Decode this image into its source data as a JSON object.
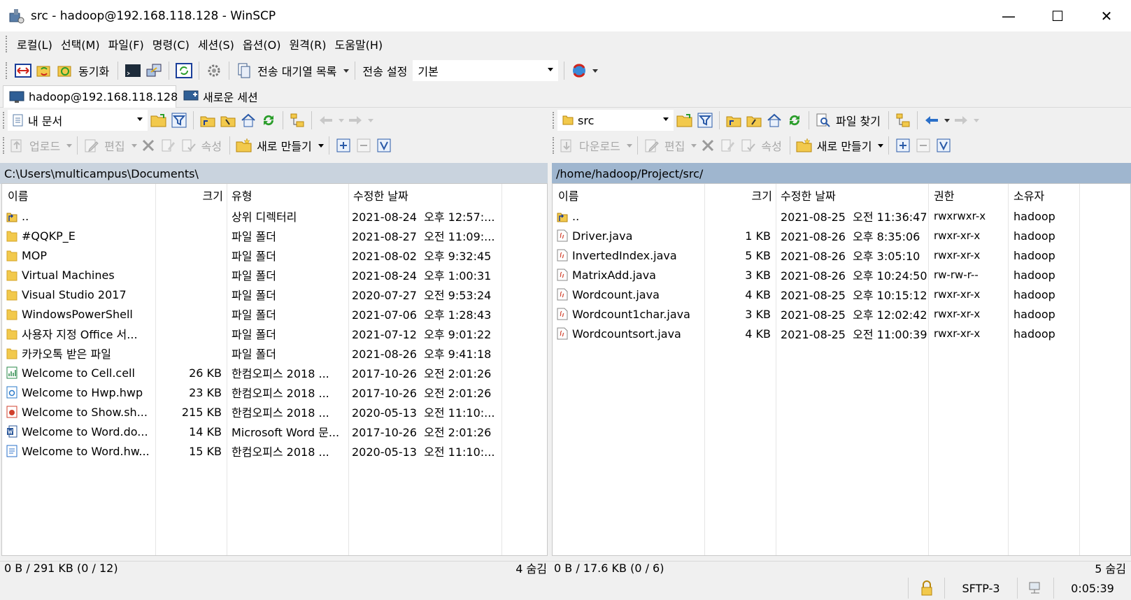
{
  "window": {
    "title": "src - hadoop@192.168.118.128 - WinSCP",
    "controls": {
      "minimize": "—",
      "maximize": "☐",
      "close": "✕"
    }
  },
  "menu": [
    "로컬(L)",
    "선택(M)",
    "파일(F)",
    "명령(C)",
    "세션(S)",
    "옵션(O)",
    "원격(R)",
    "도움말(H)"
  ],
  "toolbar": {
    "sync_label": "동기화",
    "queue_label": "전송 대기열 목록",
    "transfer_settings_label": "전송 설정",
    "transfer_preset": "기본"
  },
  "tabs": {
    "session": "hadoop@192.168.118.128",
    "new_session": "새로운 세션"
  },
  "local": {
    "location": "내 문서",
    "upload_label": "업로드",
    "edit_label": "편집",
    "properties_label": "속성",
    "new_label": "새로 만들기",
    "path": "C:\\Users\\multicampus\\Documents\\",
    "columns": {
      "name": "이름",
      "size": "크기",
      "type": "유형",
      "modified": "수정한 날짜"
    },
    "files": [
      {
        "icon": "parent-dir-icon",
        "name": "..",
        "size": "",
        "type": "상위 디렉터리",
        "modified": "2021-08-24  오후 12:57:..."
      },
      {
        "icon": "folder-icon",
        "name": "#QQKP_E",
        "size": "",
        "type": "파일 폴더",
        "modified": "2021-08-27  오전 11:09:..."
      },
      {
        "icon": "folder-icon",
        "name": "MOP",
        "size": "",
        "type": "파일 폴더",
        "modified": "2021-08-02  오후 9:32:45"
      },
      {
        "icon": "folder-icon",
        "name": "Virtual Machines",
        "size": "",
        "type": "파일 폴더",
        "modified": "2021-08-24  오후 1:00:31"
      },
      {
        "icon": "folder-icon",
        "name": "Visual Studio 2017",
        "size": "",
        "type": "파일 폴더",
        "modified": "2020-07-27  오전 9:53:24"
      },
      {
        "icon": "folder-icon",
        "name": "WindowsPowerShell",
        "size": "",
        "type": "파일 폴더",
        "modified": "2021-07-06  오후 1:28:43"
      },
      {
        "icon": "folder-icon",
        "name": "사용자 지정 Office 서...",
        "size": "",
        "type": "파일 폴더",
        "modified": "2021-07-12  오후 9:01:22"
      },
      {
        "icon": "folder-icon",
        "name": "카카오톡 받은 파일",
        "size": "",
        "type": "파일 폴더",
        "modified": "2021-08-26  오후 9:41:18"
      },
      {
        "icon": "cell-doc-icon",
        "name": "Welcome to Cell.cell",
        "size": "26 KB",
        "type": "한컴오피스 2018 ...",
        "modified": "2017-10-26  오전 2:01:26"
      },
      {
        "icon": "hwp-doc-icon",
        "name": "Welcome to Hwp.hwp",
        "size": "23 KB",
        "type": "한컴오피스 2018 ...",
        "modified": "2017-10-26  오전 2:01:26"
      },
      {
        "icon": "show-doc-icon",
        "name": "Welcome to Show.sh...",
        "size": "215 KB",
        "type": "한컴오피스 2018 ...",
        "modified": "2020-05-13  오전 11:10:..."
      },
      {
        "icon": "word-doc-icon",
        "name": "Welcome to Word.do...",
        "size": "14 KB",
        "type": "Microsoft Word 문...",
        "modified": "2017-10-26  오전 2:01:26"
      },
      {
        "icon": "hwp-word-icon",
        "name": "Welcome to Word.hw...",
        "size": "15 KB",
        "type": "한컴오피스 2018 ...",
        "modified": "2020-05-13  오전 11:10:..."
      }
    ],
    "status": "0 B / 291 KB (0 / 12)",
    "hidden": "4 숨김"
  },
  "remote": {
    "location": "src",
    "find_label": "파일 찾기",
    "download_label": "다운로드",
    "edit_label": "편집",
    "properties_label": "속성",
    "new_label": "새로 만들기",
    "path": "/home/hadoop/Project/src/",
    "columns": {
      "name": "이름",
      "size": "크기",
      "modified": "수정한 날짜",
      "rights": "권한",
      "owner": "소유자"
    },
    "files": [
      {
        "icon": "parent-dir-icon",
        "name": "..",
        "size": "",
        "modified": "2021-08-25  오전 11:36:47",
        "rights": "rwxrwxr-x",
        "owner": "hadoop"
      },
      {
        "icon": "java-file-icon",
        "name": "Driver.java",
        "size": "1 KB",
        "modified": "2021-08-26  오후 8:35:06",
        "rights": "rwxr-xr-x",
        "owner": "hadoop"
      },
      {
        "icon": "java-file-icon",
        "name": "InvertedIndex.java",
        "size": "5 KB",
        "modified": "2021-08-26  오후 3:05:10",
        "rights": "rwxr-xr-x",
        "owner": "hadoop"
      },
      {
        "icon": "java-file-icon",
        "name": "MatrixAdd.java",
        "size": "3 KB",
        "modified": "2021-08-26  오후 10:24:50",
        "rights": "rw-rw-r--",
        "owner": "hadoop"
      },
      {
        "icon": "java-file-icon",
        "name": "Wordcount.java",
        "size": "4 KB",
        "modified": "2021-08-25  오후 10:15:12",
        "rights": "rwxr-xr-x",
        "owner": "hadoop"
      },
      {
        "icon": "java-file-icon",
        "name": "Wordcount1char.java",
        "size": "3 KB",
        "modified": "2021-08-25  오후 12:02:42",
        "rights": "rwxr-xr-x",
        "owner": "hadoop"
      },
      {
        "icon": "java-file-icon",
        "name": "Wordcountsort.java",
        "size": "4 KB",
        "modified": "2021-08-25  오전 11:00:39",
        "rights": "rwxr-xr-x",
        "owner": "hadoop"
      }
    ],
    "status": "0 B / 17.6 KB (0 / 6)",
    "hidden": "5 숨김"
  },
  "statusbar": {
    "protocol": "SFTP-3",
    "elapsed": "0:05:39"
  },
  "colors": {
    "local_path_bg": "#c9d3de",
    "remote_path_bg": "#9fb6cf",
    "folder": "#e8b838",
    "accent_blue": "#2a6fc9"
  }
}
